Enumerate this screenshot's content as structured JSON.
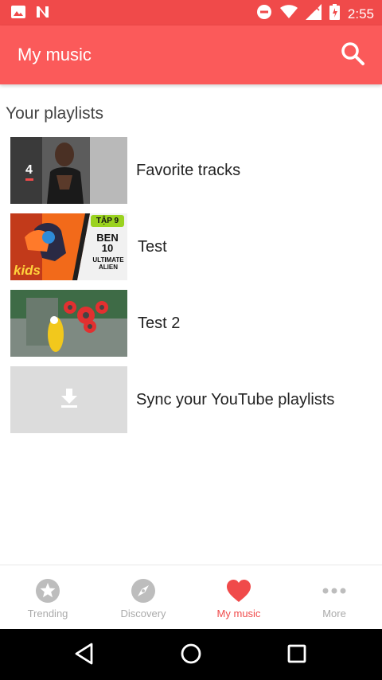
{
  "status_bar": {
    "time": "2:55",
    "left_icons": [
      "image-icon",
      "notification-n-icon"
    ],
    "right_icons": [
      "do-not-disturb-icon",
      "wifi-icon",
      "signal-icon",
      "battery-icon"
    ]
  },
  "app_bar": {
    "title": "My music",
    "search_icon": "search-icon"
  },
  "content": {
    "section_title": "Your playlists",
    "playlists": [
      {
        "label": "Favorite tracks",
        "thumb_badge": "4"
      },
      {
        "label": "Test",
        "thumb_badge": "TẬP 9",
        "thumb_logo_top": "BEN 10",
        "thumb_logo_sub": "ULTIMATE ALIEN",
        "thumb_corner": "kids"
      },
      {
        "label": "Test 2"
      },
      {
        "label": "Sync your YouTube playlists",
        "thumb_icon": "download-icon"
      }
    ]
  },
  "bottom_nav": {
    "items": [
      {
        "label": "Trending",
        "icon": "star-icon",
        "active": false
      },
      {
        "label": "Discovery",
        "icon": "compass-icon",
        "active": false
      },
      {
        "label": "My music",
        "icon": "heart-icon",
        "active": true
      },
      {
        "label": "More",
        "icon": "more-dots-icon",
        "active": false
      }
    ]
  },
  "colors": {
    "status_bar": "#f04a4a",
    "app_bar": "#fb5a5a",
    "accent": "#f04a4a",
    "inactive": "#aaaaaa"
  }
}
